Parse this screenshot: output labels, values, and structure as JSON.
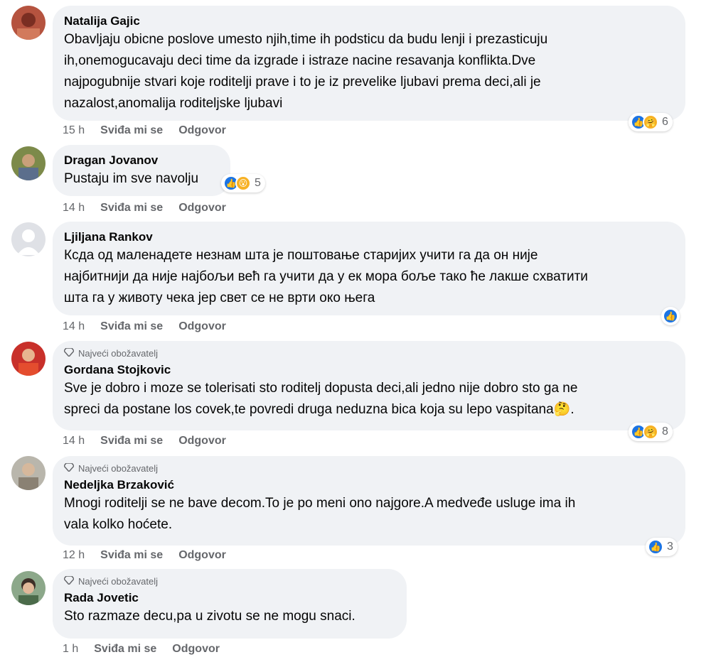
{
  "fan_badge": "Najveći obožavatelj",
  "actions": {
    "like": "Sviđa mi se",
    "reply": "Odgovor"
  },
  "comments": [
    {
      "name": "Natalija Gajic",
      "lines": [
        "Obavljaju obicne poslove umesto njih,time ih podsticu da budu lenji i prezasticuju",
        "ih,onemogucavaju deci time da izgrade i istraze nacine resavanja konflikta.Dve",
        "najpogubnije stvari koje roditelji prave i to je iz prevelike ljubavi prema deci,ali je",
        "nazalost,anomalija roditeljske ljubavi"
      ],
      "time": "15 h",
      "reaction_count": "6"
    },
    {
      "name": "Dragan Jovanov",
      "lines": [
        "Pustaju im sve navolju"
      ],
      "time": "14 h",
      "reaction_count": "5"
    },
    {
      "name": "Ljiljana Rankov",
      "lines": [
        "Ксда од маленадете незнам шта је поштовање старијих учити га да он није",
        "најбитнији да није најбољи већ га учити да у ек мора боље тако ће лакше схватити",
        "шта га у животу чека јер свет се не врти око њега"
      ],
      "time": "14 h",
      "reaction_count": ""
    },
    {
      "name": "Gordana Stojkovic",
      "lines": [
        "Sve je dobro i moze se tolerisati sto roditelj dopusta deci,ali jedno nije dobro sto ga ne",
        "spreci da postane los covek,te povredi druga neduzna bica koja su lepo vaspitana🤔."
      ],
      "time": "14 h",
      "reaction_count": "8"
    },
    {
      "name": "Nedeljka Brzaković",
      "lines": [
        "Mnogi roditelji se ne bave decom.To je po meni ono najgore.A medveđe usluge ima ih",
        "vala kolko hoćete."
      ],
      "time": "12 h",
      "reaction_count": "3"
    },
    {
      "name": "Rada Jovetic",
      "lines": [
        "Sto razmaze decu,pa u zivotu se ne mogu snaci."
      ],
      "time": "1 h",
      "reaction_count": ""
    }
  ]
}
